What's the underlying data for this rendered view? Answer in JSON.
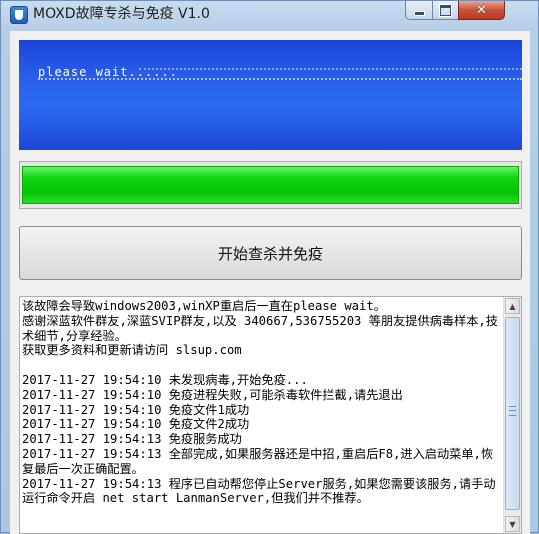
{
  "window": {
    "title": "MOXD故障专杀与免疫 V1.0",
    "close_glyph": "✕"
  },
  "banner": {
    "text": "please wait......"
  },
  "progress": {
    "value_fraction": 1.0,
    "color": "#11d511"
  },
  "actions": {
    "scan_label": "开始查杀并免疫"
  },
  "log": {
    "lines": [
      "该故障会导致windows2003,winXP重启后一直在please wait。",
      "感谢深蓝软件群友,深蓝SVIP群友,以及 340667,536755203 等朋友提供病毒样本,技术细节,分享经验。",
      "获取更多资料和更新请访问 slsup.com",
      "",
      "2017-11-27 19:54:10 未发现病毒,开始免疫...",
      "2017-11-27 19:54:10 免疫进程失败,可能杀毒软件拦截,请先退出",
      "2017-11-27 19:54:10 免疫文件1成功",
      "2017-11-27 19:54:10 免疫文件2成功",
      "2017-11-27 19:54:13 免疫服务成功",
      "2017-11-27 19:54:13 全部完成,如果服务器还是中招,重启后F8,进入启动菜单,恢复最后一次正确配置。",
      "2017-11-27 19:54:13 程序已自动帮您停止Server服务,如果您需要该服务,请手动运行命令开启 net start LanmanServer,但我们并不推荐。"
    ]
  },
  "icons": {
    "app": "shield-icon",
    "minimize": "minimize-icon",
    "maximize": "maximize-icon",
    "close": "close-icon",
    "scroll_up": "arrow-up-icon",
    "scroll_down": "arrow-down-icon"
  }
}
